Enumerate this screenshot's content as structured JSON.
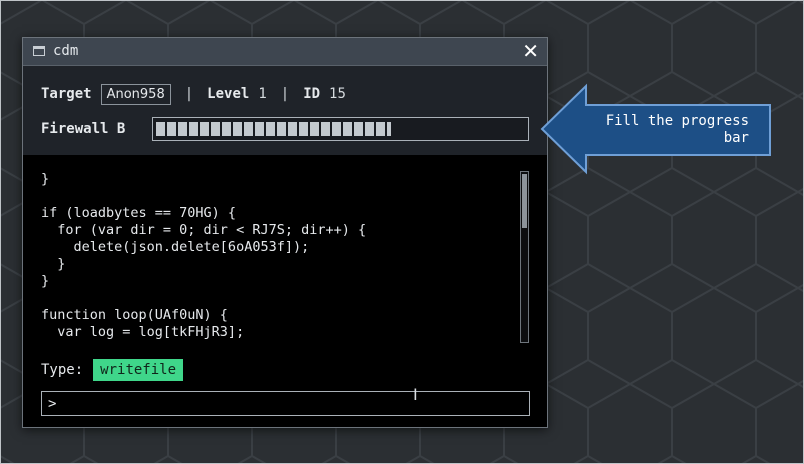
{
  "window": {
    "title": "cdm",
    "close_glyph": "✕",
    "icon": "window-icon"
  },
  "info": {
    "target_label": "Target",
    "target_value": "Anon958",
    "separator": "|",
    "level_label": "Level",
    "level_value": "1",
    "id_label": "ID",
    "id_value": "15"
  },
  "firewall": {
    "label": "Firewall B",
    "progress_fraction": 0.67
  },
  "console": {
    "code_lines": [
      "}",
      "",
      "if (loadbytes == 70HG) {",
      "  for (var dir = 0; dir < RJ7S; dir++) {",
      "    delete(json.delete[6oA053f]);",
      "  }",
      "}",
      "",
      "function loop(UAf0uN) {",
      "  var log = log[tkFHjR3];"
    ],
    "type_label": "Type:",
    "type_word": "writefile",
    "input_value": ">"
  },
  "callout": {
    "text": "Fill the progress bar"
  },
  "colors": {
    "background": "#2b2f33",
    "window_bg": "#1f2329",
    "titlebar": "#3e4650",
    "highlight_green": "#3fd68a",
    "callout_blue": "#1d4f86"
  }
}
